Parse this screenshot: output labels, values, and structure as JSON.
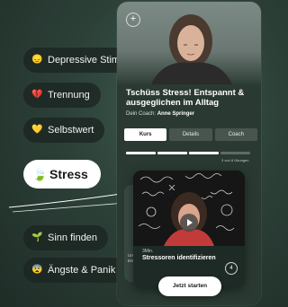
{
  "topics": [
    {
      "label": "Depressive Stimmung",
      "emoji": "😞"
    },
    {
      "label": "Trennung",
      "emoji": "💔"
    },
    {
      "label": "Selbstwert",
      "emoji": "💛"
    },
    {
      "label": "Stress",
      "emoji": "🍃"
    },
    {
      "label": "Sinn finden",
      "emoji": "🌱"
    },
    {
      "label": "Ängste & Panik",
      "emoji": "😨"
    }
  ],
  "active_topic": "Stress",
  "course": {
    "title": "Tschüss Stress! Entspannt & ausgeglichen im Alltag",
    "coach_prefix": "Dein Coach:",
    "coach_name": "Anne Springer",
    "tabs": [
      "Kurs",
      "Details",
      "Coach"
    ],
    "active_tab": "Kurs",
    "progress_text": "3 von 8 Übungen",
    "progress_done": 3,
    "progress_total": 8
  },
  "lesson_card": {
    "duration": "3Min.",
    "title": "Stressoren identifizieren",
    "number": "4"
  },
  "back_card_text": "Um Ent",
  "start_button": "Jetzt starten",
  "colors": {
    "background": "#2c4038",
    "pill": "#1c2622",
    "active_pill": "#ffffff"
  },
  "icons": [
    "plus-icon",
    "play-icon"
  ]
}
